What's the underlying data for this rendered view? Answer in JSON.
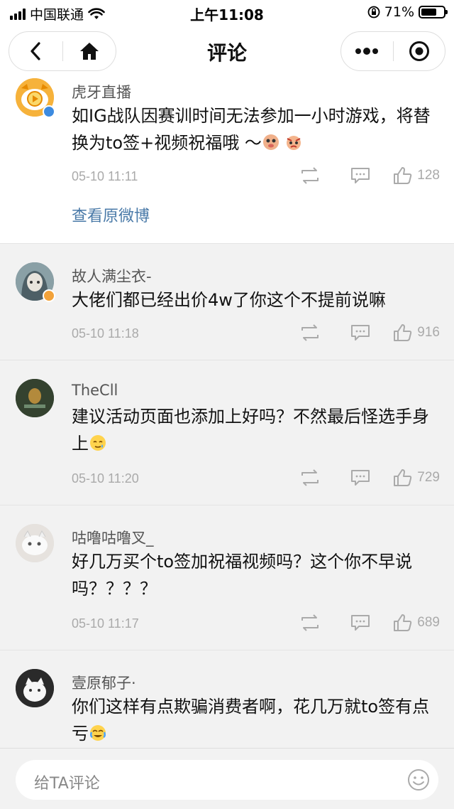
{
  "status_bar": {
    "carrier": "中国联通",
    "time": "上午11:08",
    "battery": "71%",
    "battery_level": 0.71
  },
  "nav": {
    "title": "评论"
  },
  "main_post": {
    "author": "虎牙直播",
    "text": "如IG战队因赛训时间无法参加一小时游戏，将替换为to签+视频祝福哦 ～",
    "time": "05-10 11:11",
    "likes": "128",
    "view_original": "查看原微博"
  },
  "comments": [
    {
      "author": "故人满尘衣-",
      "text": "大佬们都已经出价4w了你这个不提前说嘛",
      "time": "05-10 11:18",
      "likes": "916"
    },
    {
      "author": "TheCll",
      "text": "建议活动页面也添加上好吗？不然最后怪选手身上",
      "time": "05-10 11:20",
      "likes": "729"
    },
    {
      "author": "咕噜咕噜叉_",
      "text": "好几万买个to签加祝福视频吗？这个你不早说吗？？？？",
      "time": "05-10 11:17",
      "likes": "689"
    },
    {
      "author": "壹原郁子·",
      "text": "你们这样有点欺骗消费者啊，花几万就to签有点亏"
    }
  ],
  "comment_input": {
    "placeholder": "给TA评论"
  },
  "colors": {
    "link": "#4a7aa8",
    "verified_blue": "#3d8be0",
    "verified_orange": "#f2a23a"
  }
}
